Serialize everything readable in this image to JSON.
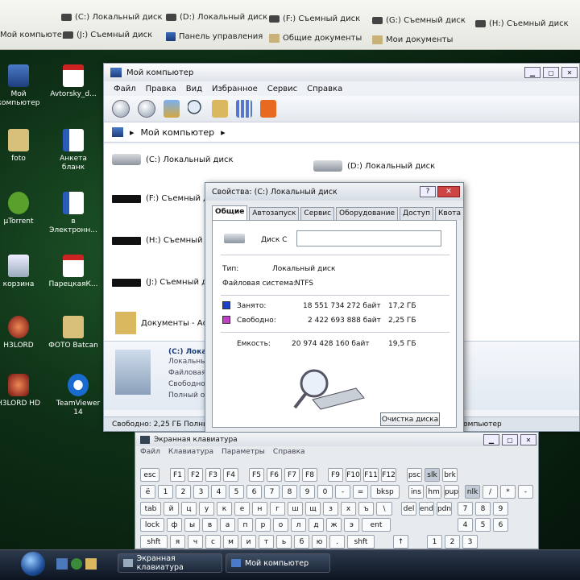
{
  "topbar": {
    "row1": [
      "(C:) Локальный диск",
      "(D:) Локальный диск",
      "(F:) Съемный диск",
      "(G:) Съемный диск",
      "(H:) Съемный диск"
    ],
    "row2": [
      "Мой компьютер",
      "(J:) Съемный диск",
      "Панель управления",
      "Общие документы",
      "Мои документы"
    ]
  },
  "desktop": {
    "icons": [
      "Мой компьютер",
      "Avtorsky_d...",
      "foto",
      "Анкета бланк",
      "µTorrent",
      "в Электронн...",
      "корзина",
      "ПарецкаяК...",
      "H3LORD",
      "ФОТО Batcan",
      "H3LORD HD",
      "TeamViewer 14"
    ]
  },
  "explorer": {
    "title": "Мой компьютер",
    "menu": [
      "Файл",
      "Правка",
      "Вид",
      "Избранное",
      "Сервис",
      "Справка"
    ],
    "address": "Мой компьютер",
    "drives": [
      "(C:) Локальный диск",
      "(D:) Локальный диск",
      "(F:) Съемный ди",
      "(H:) Съемный ди",
      "(J:) Съемный ди",
      "Документы - Ас"
    ],
    "detail": [
      "(C:) Локал",
      "Локальны",
      "Файловая",
      "Свободно",
      "Полный о"
    ],
    "status_left": "Свободно: 2,25 ГБ Полный",
    "status_right": "й компьютер"
  },
  "props": {
    "title": "Свойства: (C:) Локальный диск",
    "help": "?",
    "close": "✕",
    "tabs": [
      "Общие",
      "Автозапуск",
      "Сервис",
      "Оборудование",
      "Доступ",
      "Квота"
    ],
    "disk_label": "Диск C",
    "type_label": "Тип:",
    "type_value": "Локальный диск",
    "fs_label": "Файловая система:",
    "fs_value": "NTFS",
    "used_label": "Занято:",
    "used_bytes": "18 551 734 272 байт",
    "used_gb": "17,2 ГБ",
    "free_label": "Свободно:",
    "free_bytes": "2 422 693 888 байт",
    "free_gb": "2,25 ГБ",
    "cap_label": "Емкость:",
    "cap_bytes": "20 974 428 160 байт",
    "cap_gb": "19,5 ГБ",
    "cleanup": "Очистка диска",
    "used_color": "#1e40c8",
    "free_color": "#c040c8"
  },
  "osk": {
    "title": "Экранная клавиатура",
    "menu": [
      "Файл",
      "Клавиатура",
      "Параметры",
      "Справка"
    ],
    "rows": [
      [
        "esc",
        "F1",
        "F2",
        "F3",
        "F4",
        "F5",
        "F6",
        "F7",
        "F8",
        "F9",
        "F10",
        "F11",
        "F12",
        "psc",
        "slk",
        "brk"
      ],
      [
        "ё",
        "1",
        "2",
        "3",
        "4",
        "5",
        "6",
        "7",
        "8",
        "9",
        "0",
        "-",
        "=",
        "bksp",
        "ins",
        "hm",
        "pup",
        "nlk",
        "/",
        "*",
        "-"
      ],
      [
        "tab",
        "й",
        "ц",
        "у",
        "к",
        "е",
        "н",
        "г",
        "ш",
        "щ",
        "з",
        "х",
        "ъ",
        "\\",
        "del",
        "end",
        "pdn",
        "7",
        "8",
        "9"
      ],
      [
        "lock",
        "ф",
        "ы",
        "в",
        "а",
        "п",
        "р",
        "о",
        "л",
        "д",
        "ж",
        "э",
        "ent",
        "4",
        "5",
        "6"
      ],
      [
        "shft",
        "я",
        "ч",
        "с",
        "м",
        "и",
        "т",
        "ь",
        "б",
        "ю",
        ".",
        "shft",
        "↑",
        "1",
        "2",
        "3"
      ]
    ]
  },
  "taskbar": {
    "items": [
      "Экранная клавиатура",
      "Мой компьютер"
    ]
  }
}
